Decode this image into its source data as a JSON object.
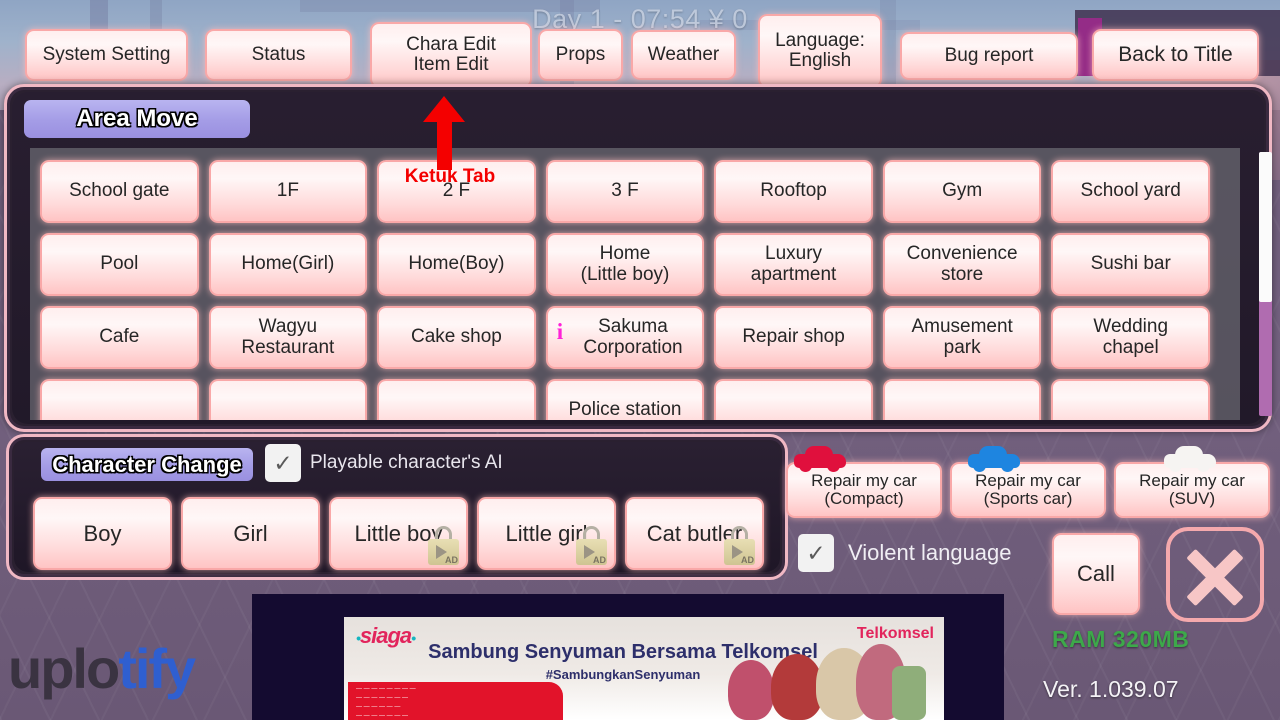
{
  "hud": {
    "status_line": "Day 1 - 07:54  ¥ 0"
  },
  "topbar": {
    "buttons": [
      {
        "label": "System Setting"
      },
      {
        "label": "Status"
      },
      {
        "label": "Chara Edit\nItem Edit"
      },
      {
        "label": "Props"
      },
      {
        "label": "Weather"
      },
      {
        "label": "Language:\nEnglish"
      },
      {
        "label": "Bug report"
      },
      {
        "label": "Back to Title"
      }
    ]
  },
  "area_panel": {
    "title": "Area Move",
    "areas": [
      {
        "label": "School gate"
      },
      {
        "label": "1F"
      },
      {
        "label": "2 F"
      },
      {
        "label": "3 F"
      },
      {
        "label": "Rooftop"
      },
      {
        "label": "Gym"
      },
      {
        "label": "School yard"
      },
      {
        "label": "Pool"
      },
      {
        "label": "Home(Girl)"
      },
      {
        "label": "Home(Boy)"
      },
      {
        "label": "Home\n(Little boy)"
      },
      {
        "label": "Luxury\napartment"
      },
      {
        "label": "Convenience\nstore"
      },
      {
        "label": "Sushi bar"
      },
      {
        "label": "Cafe"
      },
      {
        "label": "Wagyu\nRestaurant"
      },
      {
        "label": "Cake shop"
      },
      {
        "label": "Sakuma\nCorporation",
        "info_icon": "i"
      },
      {
        "label": "Repair shop"
      },
      {
        "label": "Amusement\npark"
      },
      {
        "label": "Wedding\nchapel"
      },
      {
        "label": ""
      },
      {
        "label": ""
      },
      {
        "label": ""
      },
      {
        "label": "Police station"
      },
      {
        "label": ""
      },
      {
        "label": ""
      },
      {
        "label": ""
      }
    ]
  },
  "annotation": {
    "label": "Ketuk Tab",
    "color": "#f40000"
  },
  "character_panel": {
    "title": "Character Change",
    "ai_checkbox": {
      "label": "Playable character's AI",
      "checked": true,
      "check_glyph": "✓"
    },
    "characters": [
      {
        "label": "Boy",
        "locked": false
      },
      {
        "label": "Girl",
        "locked": false
      },
      {
        "label": "Little boy",
        "locked": true,
        "badge": "AD"
      },
      {
        "label": "Little girl",
        "locked": true,
        "badge": "AD"
      },
      {
        "label": "Cat butler",
        "locked": true,
        "badge": "AD"
      }
    ]
  },
  "side_controls": {
    "cars": [
      {
        "label": "Repair my car\n(Compact)",
        "icon_color": "#e0103d"
      },
      {
        "label": "Repair my car\n(Sports car)",
        "icon_color": "#1e85e0"
      },
      {
        "label": "Repair my car\n(SUV)",
        "icon_color": "#f6f4f2"
      }
    ],
    "violent_checkbox": {
      "label": "Violent language",
      "checked": true,
      "check_glyph": "✓"
    },
    "call_label": "Call",
    "close_icon": "close-icon"
  },
  "footer": {
    "ram": "RAM 320MB",
    "version": "Ver. 1.039.07",
    "ram_color": "#3da84a"
  },
  "ad": {
    "logo": "siaga",
    "headline": "Sambung Senyuman Bersama Telkomsel",
    "subline": "#SambungkanSenyuman",
    "brand": "Telkomsel"
  },
  "watermark": {
    "part1": "uplo",
    "part2": "tify"
  }
}
